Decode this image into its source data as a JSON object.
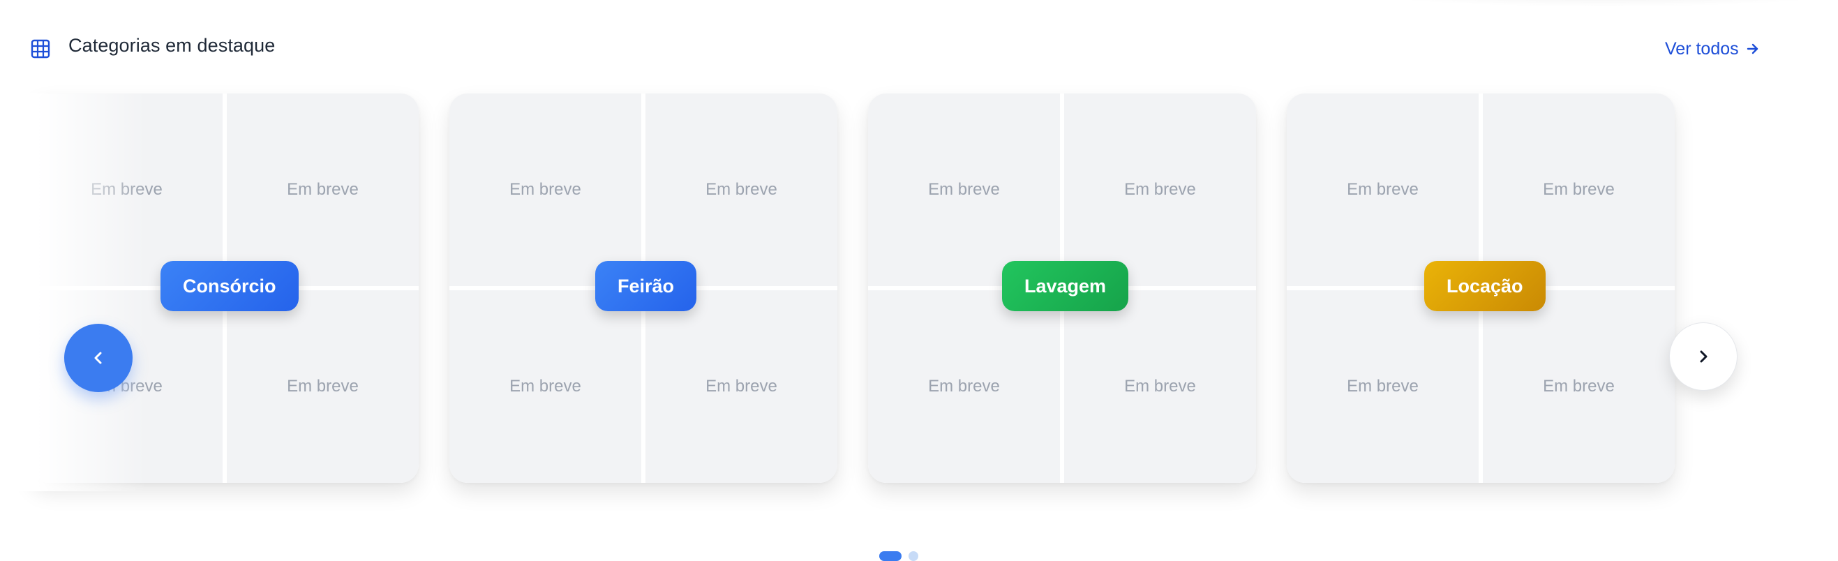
{
  "header": {
    "icon": "grid-icon",
    "title": "Categorias em destaque",
    "see_all_label": "Ver todos",
    "see_all_icon": "arrow-right-icon",
    "accent_color": "#1d4ed8"
  },
  "categories": [
    {
      "label": "Consórcio",
      "color": "#2f6fe8",
      "placeholders": [
        "Em breve",
        "Em breve",
        "Em breve",
        "Em breve"
      ]
    },
    {
      "label": "Feirão",
      "color": "#2f6fe8",
      "placeholders": [
        "Em breve",
        "Em breve",
        "Em breve",
        "Em breve"
      ]
    },
    {
      "label": "Lavagem",
      "color": "#1fb055",
      "placeholders": [
        "Em breve",
        "Em breve",
        "Em breve",
        "Em breve"
      ]
    },
    {
      "label": "Locação",
      "color": "#d39b0a",
      "placeholders": [
        "Em breve",
        "Em breve",
        "Em breve",
        "Em breve"
      ]
    }
  ],
  "navigation": {
    "prev_icon": "chevron-left-icon",
    "next_icon": "chevron-right-icon"
  },
  "pagination": {
    "current_page": 1,
    "total_pages": 2
  }
}
